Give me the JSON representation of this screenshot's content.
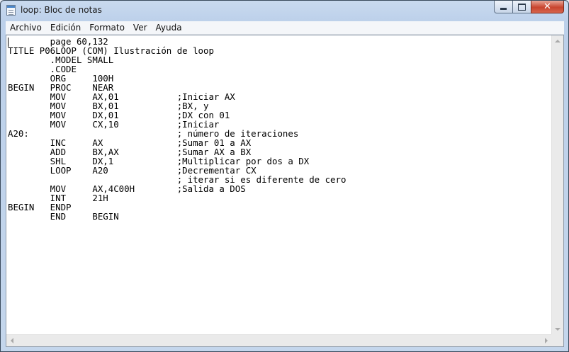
{
  "window": {
    "title": "loop: Bloc de notas",
    "close_glyph": "✕"
  },
  "menu": [
    {
      "label": "Archivo"
    },
    {
      "label": "Edición"
    },
    {
      "label": "Formato"
    },
    {
      "label": "Ver"
    },
    {
      "label": "Ayuda"
    }
  ],
  "editor": {
    "content": "        page 60,132\nTITLE P06LOOP (COM) Ilustración de loop\n        .MODEL SMALL\n        .CODE\n        ORG     100H\nBEGIN   PROC    NEAR\n        MOV     AX,01           ;Iniciar AX\n        MOV     BX,01           ;BX, y\n        MOV     DX,01           ;DX con 01\n        MOV     CX,10           ;Iniciar\nA20:                            ; número de iteraciones\n        INC     AX              ;Sumar 01 a AX\n        ADD     BX,AX           ;Sumar AX a BX\n        SHL     DX,1            ;Multiplicar por dos a DX\n        LOOP    A20             ;Decrementar CX\n                                ; iterar si es diferente de cero\n        MOV     AX,4C00H        ;Salida a DOS\n        INT     21H\nBEGIN   ENDP\n        END     BEGIN"
  },
  "icons": {
    "app": "notepad-icon",
    "minimize": "minimize-icon",
    "maximize": "maximize-icon",
    "close": "close-icon"
  }
}
